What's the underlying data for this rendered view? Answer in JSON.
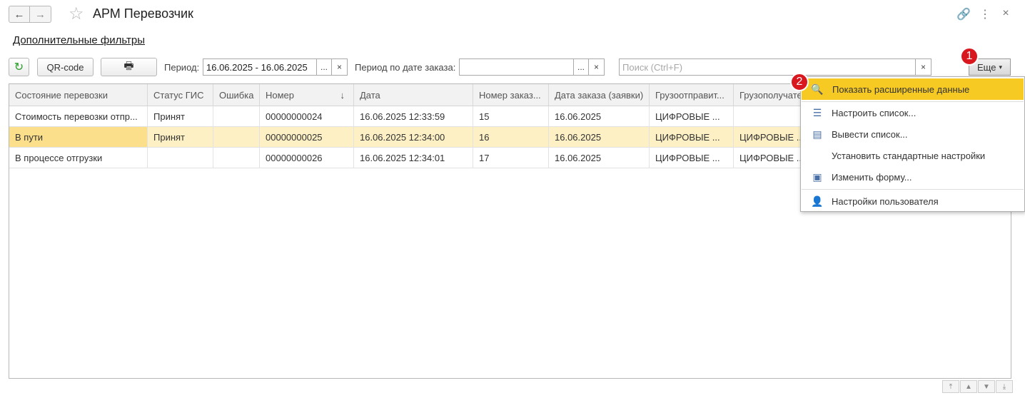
{
  "header": {
    "title": "АРМ Перевозчик",
    "back_icon": "←",
    "forward_icon": "→",
    "star_icon": "☆",
    "link_icon": "🔗",
    "more_icon": "⋮",
    "close_icon": "×"
  },
  "filters_link": "Дополнительные фильтры",
  "toolbar": {
    "refresh_icon": "↻",
    "qr_label": "QR-code",
    "print_icon": "🖶",
    "period_label": "Период:",
    "period_value": "16.06.2025 - 16.06.2025",
    "ellipsis": "...",
    "clear": "×",
    "order_period_label": "Период по дате заказа:",
    "order_period_value": "",
    "search_placeholder": "Поиск (Ctrl+F)",
    "more_label": "Еще",
    "more_arrow": "▾"
  },
  "badges": {
    "one": "1",
    "two": "2"
  },
  "table": {
    "columns": [
      "Состояние перевозки",
      "Статус ГИС",
      "Ошибка",
      "Номер",
      "Дата",
      "Номер заказ...",
      "Дата заказа (заявки)",
      "Грузоотправит...",
      "Грузополучате..."
    ],
    "sort_icon": "↓",
    "rows": [
      [
        "Стоимость перевозки отпр...",
        "Принят",
        "",
        "00000000024",
        "16.06.2025 12:33:59",
        "15",
        "16.06.2025",
        "ЦИФРОВЫЕ ...",
        ""
      ],
      [
        "В пути",
        "Принят",
        "",
        "00000000025",
        "16.06.2025 12:34:00",
        "16",
        "16.06.2025",
        "ЦИФРОВЫЕ ...",
        "ЦИФРОВЫЕ ..."
      ],
      [
        "В процессе отгрузки",
        "",
        "",
        "00000000026",
        "16.06.2025 12:34:01",
        "17",
        "16.06.2025",
        "ЦИФРОВЫЕ ...",
        "ЦИФРОВЫЕ ..."
      ]
    ]
  },
  "menu": {
    "items": [
      {
        "label": "Показать расширенные данные",
        "icon": "🔍"
      },
      {
        "label": "Настроить список...",
        "icon": "☰"
      },
      {
        "label": "Вывести список...",
        "icon": "▤"
      },
      {
        "label": "Установить стандартные настройки",
        "icon": ""
      },
      {
        "label": "Изменить форму...",
        "icon": "▣"
      },
      {
        "label": "Настройки пользователя",
        "icon": "👤"
      }
    ]
  },
  "scroll": {
    "top": "⤒",
    "up": "▲",
    "down": "▼",
    "bottom": "⤓"
  },
  "colors": {
    "selected_row": "#fdf0c4",
    "selected_cell": "#fbdf8b",
    "menu_highlight": "#f6c923",
    "badge": "#d9171e"
  }
}
